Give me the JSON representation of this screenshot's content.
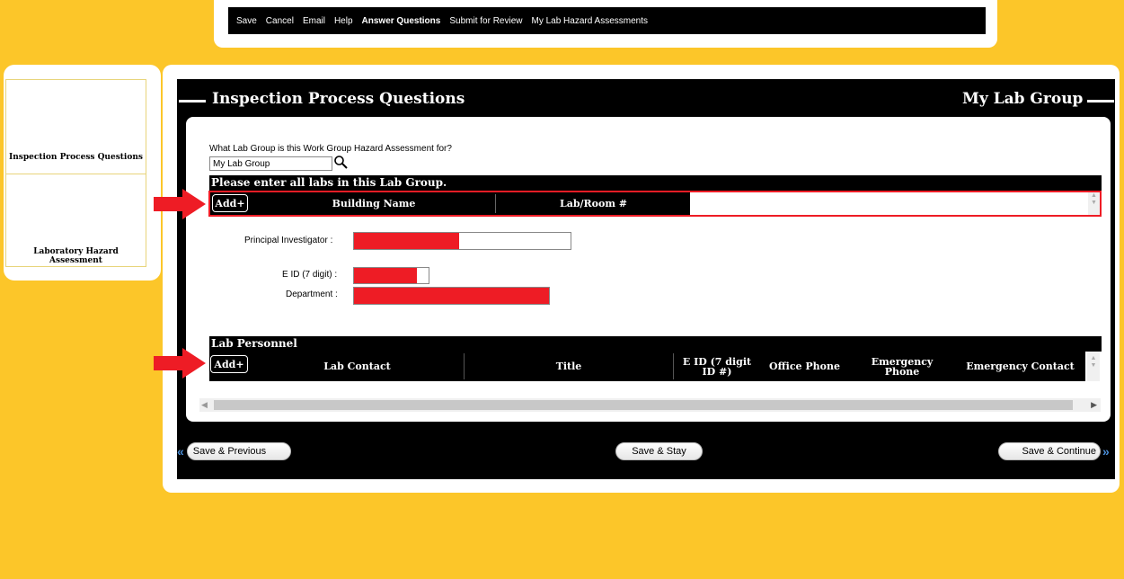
{
  "menu": {
    "items": [
      "Save",
      "Cancel",
      "Email",
      "Help",
      "Answer Questions",
      "Submit for Review",
      "My Lab Hazard Assessments"
    ],
    "active_index": 4
  },
  "sidebar": {
    "items": [
      {
        "label": "Inspection Process Questions"
      },
      {
        "label": "Laboratory Hazard Assessment"
      }
    ]
  },
  "header": {
    "title": "Inspection Process Questions",
    "right_title": "My Lab Group"
  },
  "lab_group": {
    "question": "What Lab Group is this Work Group Hazard Assessment for?",
    "value": "My Lab Group",
    "search_icon": "magnifier-icon"
  },
  "labs_section": {
    "title": "Please enter all labs in this Lab Group.",
    "add_label": "Add+",
    "columns": [
      "Building Name",
      "Lab/Room #"
    ]
  },
  "fields": {
    "pi_label": "Principal Investigator  :",
    "eid_label": "E ID (7 digit)  :",
    "dept_label": "Department  :"
  },
  "personnel_section": {
    "title": "Lab Personnel",
    "add_label": "Add+",
    "columns": [
      "Lab Contact",
      "Title",
      "E ID (7 digit ID #)",
      "Office Phone",
      "Emergency Phone",
      "Emergency Contact"
    ]
  },
  "footer": {
    "prev_label": "Save & Previous",
    "stay_label": "Save & Stay",
    "next_label": "Save & Continue"
  },
  "colors": {
    "background": "#fcc629",
    "highlight_red": "#ee1c25",
    "accent_blue": "#4a8ed8"
  }
}
